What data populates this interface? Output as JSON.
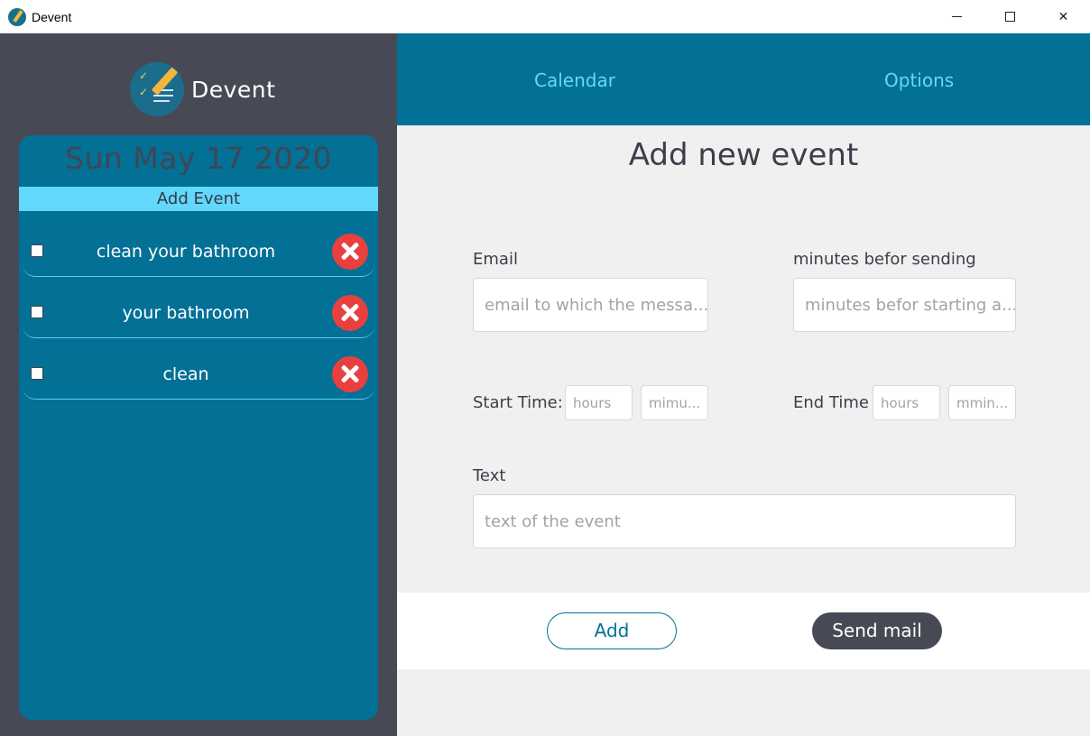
{
  "window": {
    "title": "Devent",
    "controls": [
      "minimize",
      "maximize",
      "close"
    ]
  },
  "brand": {
    "name": "Devent"
  },
  "sidebar": {
    "date": "Sun May 17 2020",
    "add_event_label": "Add Event",
    "todos": [
      {
        "text": "clean your bathroom",
        "checked": false
      },
      {
        "text": "your bathroom",
        "checked": false
      },
      {
        "text": "clean",
        "checked": false
      }
    ]
  },
  "nav": {
    "calendar": "Calendar",
    "options": "Options"
  },
  "form": {
    "title": "Add new event",
    "email_label": "Email",
    "email_placeholder": "email to which the messa...",
    "minutes_label": "minutes befor sending",
    "minutes_placeholder": "minutes befor starting a...",
    "start_label": "Start Time:",
    "start_hours_placeholder": "hours",
    "start_minutes_placeholder": "mimu...",
    "end_label": "End Time",
    "end_hours_placeholder": "hours",
    "end_minutes_placeholder": "mmin...",
    "text_label": "Text",
    "text_placeholder": "text of the event"
  },
  "actions": {
    "add": "Add",
    "send_mail": "Send mail"
  },
  "colors": {
    "primary": "#037096",
    "accent": "#63d9fb",
    "dark": "#474a55",
    "danger": "#e8403f"
  }
}
